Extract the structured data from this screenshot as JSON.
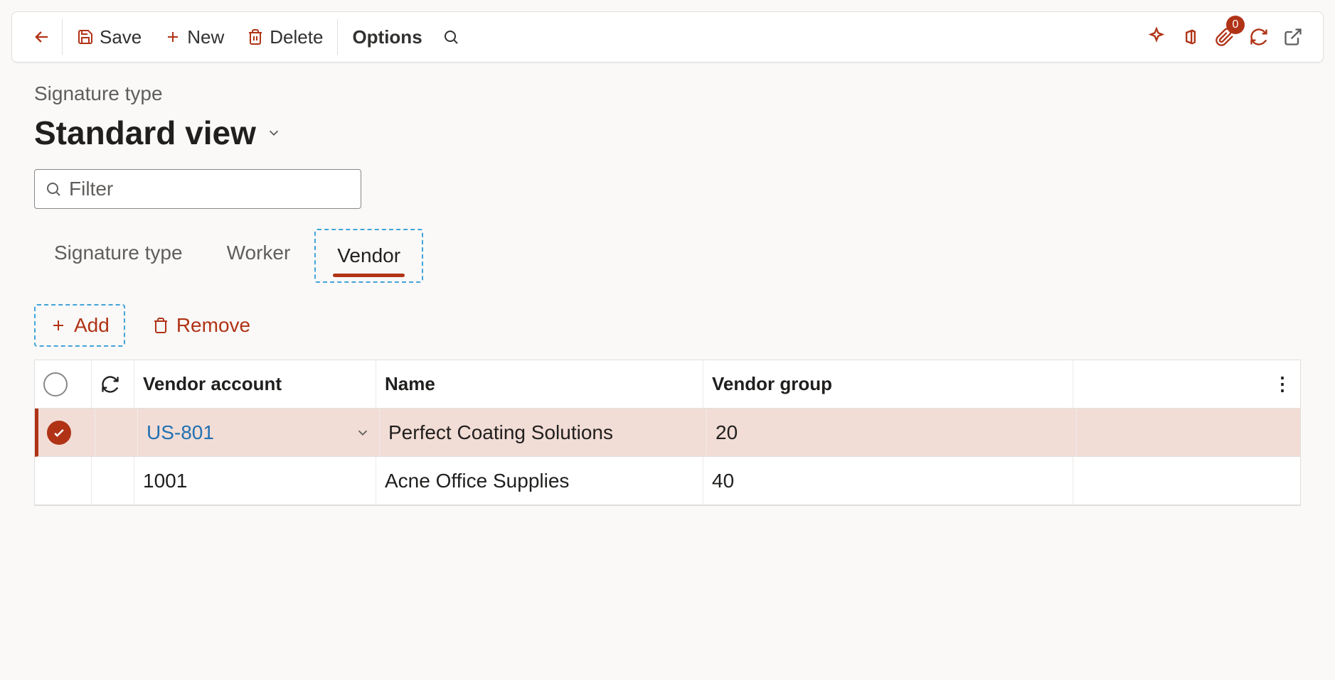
{
  "toolbar": {
    "save_label": "Save",
    "new_label": "New",
    "delete_label": "Delete",
    "options_label": "Options",
    "attach_badge": "0"
  },
  "page": {
    "breadcrumb": "Signature type",
    "title": "Standard view"
  },
  "filter": {
    "placeholder": "Filter",
    "value": ""
  },
  "tabs": {
    "items": [
      {
        "label": "Signature type"
      },
      {
        "label": "Worker"
      },
      {
        "label": "Vendor"
      }
    ],
    "active_index": 2
  },
  "sub_actions": {
    "add_label": "Add",
    "remove_label": "Remove"
  },
  "grid": {
    "columns": {
      "vendor_account": "Vendor account",
      "name": "Name",
      "vendor_group": "Vendor group"
    },
    "rows": [
      {
        "vendor_account": "US-801",
        "name": "Perfect Coating Solutions",
        "vendor_group": "20",
        "selected": true
      },
      {
        "vendor_account": "1001",
        "name": "Acne Office Supplies",
        "vendor_group": "40",
        "selected": false
      }
    ]
  }
}
